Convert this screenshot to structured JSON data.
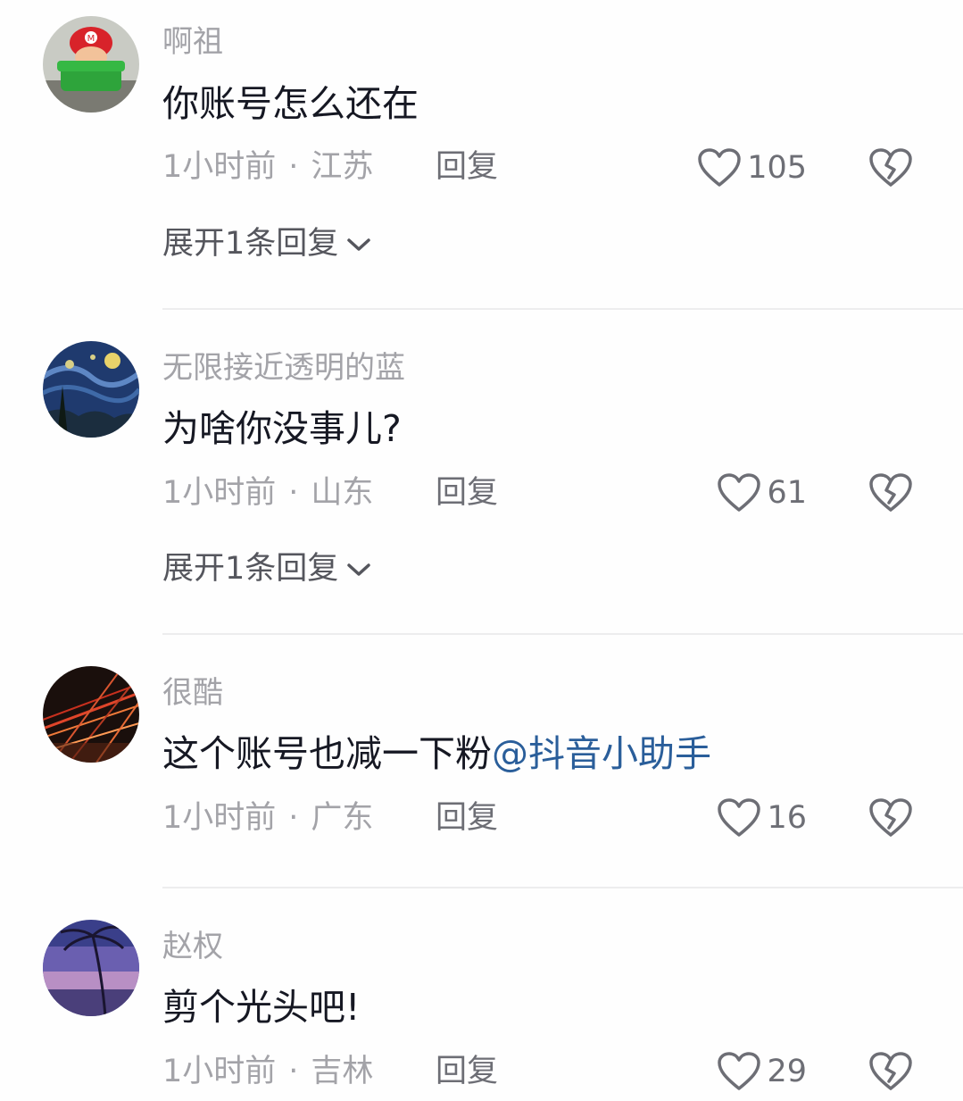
{
  "comments": [
    {
      "username": "啊祖",
      "content": "你账号怎么还在",
      "time": "1小时前",
      "separator": "·",
      "location": "江苏",
      "reply_label": "回复",
      "likes": "105",
      "expand_label": "展开1条回复",
      "avatar_icon": "mario-in-pipe-avatar"
    },
    {
      "username": "无限接近透明的蓝",
      "content": "为啥你没事儿?",
      "time": "1小时前",
      "separator": "·",
      "location": "山东",
      "reply_label": "回复",
      "likes": "61",
      "expand_label": "展开1条回复",
      "avatar_icon": "starry-night-avatar"
    },
    {
      "username": "很酷",
      "content": "这个账号也减一下粉",
      "mention": "@抖音小助手",
      "time": "1小时前",
      "separator": "·",
      "location": "广东",
      "reply_label": "回复",
      "likes": "16",
      "avatar_icon": "red-light-streaks-avatar"
    },
    {
      "username": "赵权",
      "content": "剪个光头吧!",
      "time": "1小时前",
      "separator": "·",
      "location": "吉林",
      "reply_label": "回复",
      "likes": "29",
      "avatar_icon": "palm-tree-sunset-avatar"
    }
  ],
  "colors": {
    "username": "#a3a3a8",
    "content": "#161823",
    "mention": "#2a5e9a",
    "action": "#6d6e75",
    "divider": "#ededee"
  }
}
